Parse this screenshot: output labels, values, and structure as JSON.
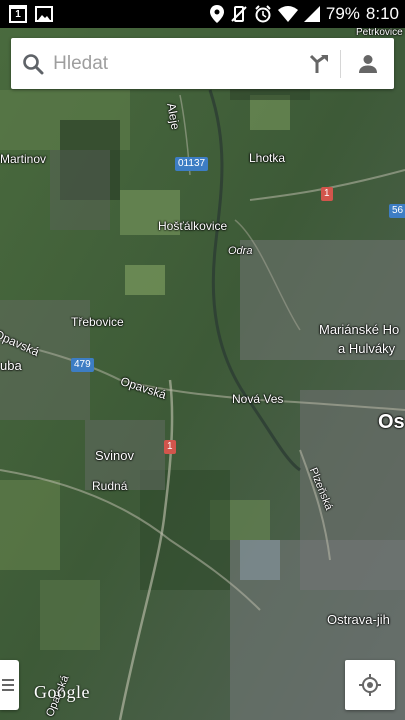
{
  "status_bar": {
    "calendar_day": "1",
    "battery": "79%",
    "time": "8:10",
    "icons": [
      "calendar-icon",
      "image-icon",
      "location-pin-icon",
      "vibrate-off-icon",
      "alarm-icon",
      "wifi-icon",
      "signal-icon",
      "battery-icon"
    ]
  },
  "search": {
    "placeholder": "Hledat"
  },
  "map": {
    "labels": {
      "petrkovice": "Petrkovice",
      "aleje": "Aleje",
      "martinov": "Martinov",
      "lhotka": "Lhotka",
      "hostalkovice": "Hošťálkovice",
      "odra": "Odra",
      "trebovice": "Třebovice",
      "opavska_west": "Opavská",
      "uba": "uba",
      "marianske_hory_1": "Mariánské Ho",
      "marianske_hory_2": "a Hulváky",
      "opavska": "Opavská",
      "nova_ves": "Nová Ves",
      "os": "Os",
      "svinov": "Svinov",
      "rudna": "Rudná",
      "plzenska": "Plzeňská",
      "ostrava_jih": "Ostrava-jih",
      "opavska_south": "Opavská"
    },
    "shields": {
      "s01137": "01137",
      "s1_top": "1",
      "s56": "56",
      "s479": "479",
      "s1_mid": "1"
    }
  },
  "logo": "Google",
  "colors": {
    "shield_red": "#d2554c",
    "shield_blue": "#3d7dc4",
    "map_dark": "#3f5a3c"
  }
}
